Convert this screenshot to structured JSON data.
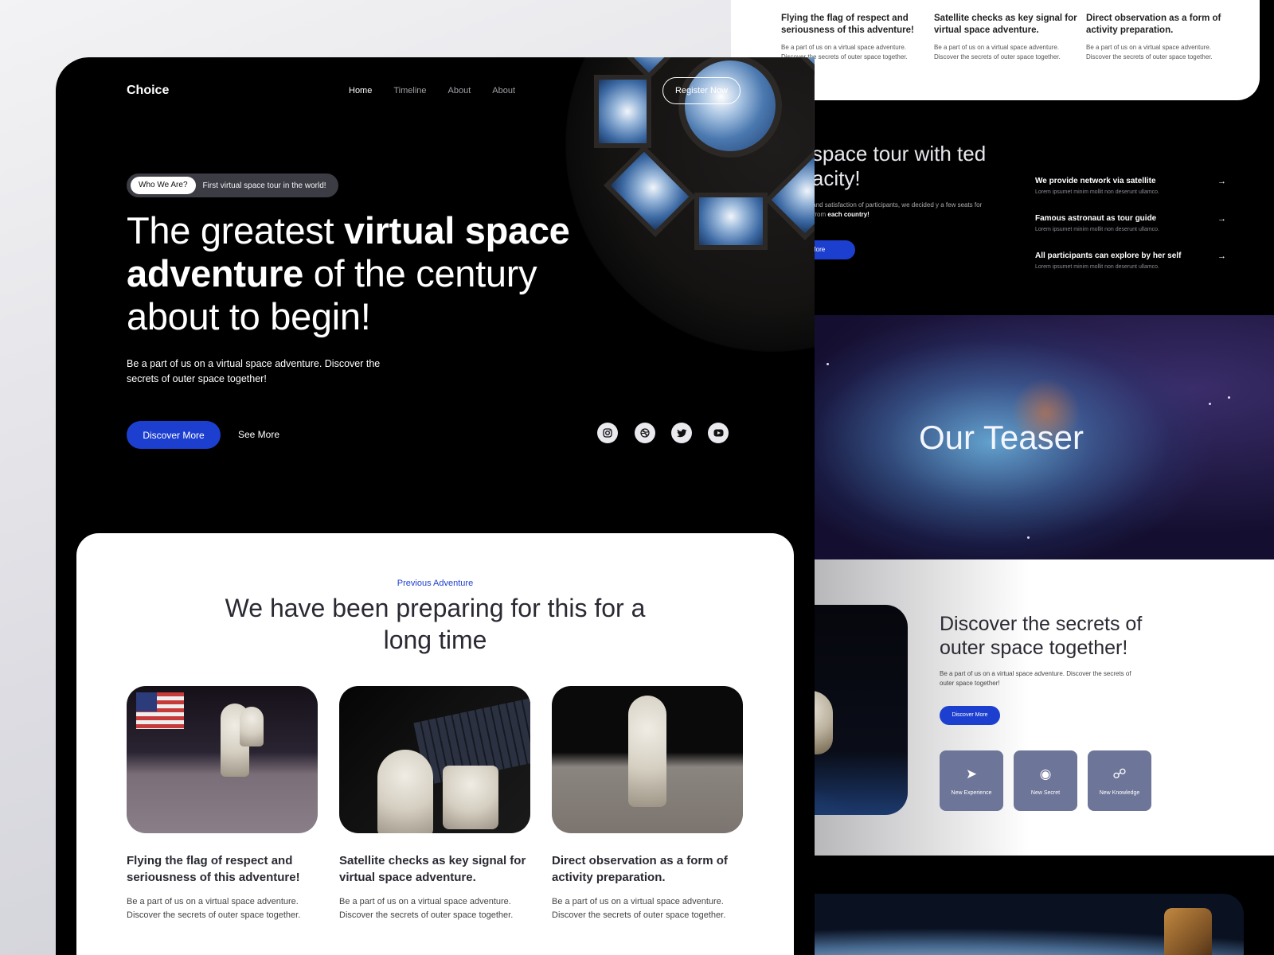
{
  "front": {
    "brand": "Choice",
    "nav": [
      "Home",
      "Timeline",
      "About",
      "About"
    ],
    "register": "Register Now",
    "who_tag": "Who We Are?",
    "who_text": "First virtual space tour in the world!",
    "headline": {
      "l1_light": "The greatest ",
      "l1_bold": "virtual space",
      "l2_bold": "adventure",
      "l2_light": " of the century",
      "l3_light": "about to begin!"
    },
    "hero_desc": "Be a part of us on a virtual space adventure. Discover the secrets of outer space together!",
    "discover_btn": "Discover More",
    "see_more": "See More",
    "social_icons": [
      "instagram-icon",
      "dribbble-icon",
      "twitter-icon",
      "youtube-icon"
    ],
    "prev": {
      "kicker": "Previous Adventure",
      "title": "We have been preparing for this for a long time",
      "cards": [
        {
          "title": "Flying the flag of respect and seriousness of this adventure!",
          "desc": "Be a part of us on a virtual space adventure. Discover the secrets of outer space together."
        },
        {
          "title": "Satellite checks as key signal for virtual space adventure.",
          "desc": "Be a part of us on a virtual space adventure. Discover the secrets of outer space together."
        },
        {
          "title": "Direct observation as a form of activity preparation.",
          "desc": "Be a part of us on a virtual space adventure. Discover the secrets of outer space together."
        }
      ]
    }
  },
  "back": {
    "mini_cards": [
      {
        "title": "Flying the flag of respect and seriousness of this adventure!",
        "desc": "Be a part of us on a virtual space adventure. Discover the secrets of outer space together."
      },
      {
        "title": "Satellite checks as key signal for virtual space adventure.",
        "desc": "Be a part of us on a virtual space adventure. Discover the secrets of outer space together."
      },
      {
        "title": "Direct observation as a form of activity preparation.",
        "desc": "Be a part of us on a virtual space adventure. Discover the secrets of outer space together."
      }
    ],
    "tour_title": "ual space tour with ted capacity!",
    "tour_desc": "the comfort and satisfaction of participants, we decided y a few seats for participants from",
    "tour_desc_bold": "each country!",
    "tour_btn": "More",
    "features": [
      {
        "title": "We provide network via satellite",
        "desc": "Lorem ipsumet minim mollit non deserunt ullamco."
      },
      {
        "title": "Famous astronaut as tour guide",
        "desc": "Lorem ipsumet minim mollit non deserunt ullamco."
      },
      {
        "title": "All participants can explore by her self",
        "desc": "Lorem ipsumet minim mollit non deserunt ullamco."
      }
    ],
    "teaser": "Our Teaser",
    "discover_title": "Discover the secrets of outer space together!",
    "discover_desc": "Be a part of us on a virtual space adventure. Discover the secrets of outer space together!",
    "discover_btn": "Discover More",
    "tiles": [
      {
        "label": "New Experience",
        "icon": "send-icon"
      },
      {
        "label": "New Secret",
        "icon": "eye-icon"
      },
      {
        "label": "New Knowledge",
        "icon": "globe-icon"
      }
    ]
  },
  "colors": {
    "accent": "#1d3fcf",
    "dark": "#000000",
    "tile": "#6d7598"
  }
}
